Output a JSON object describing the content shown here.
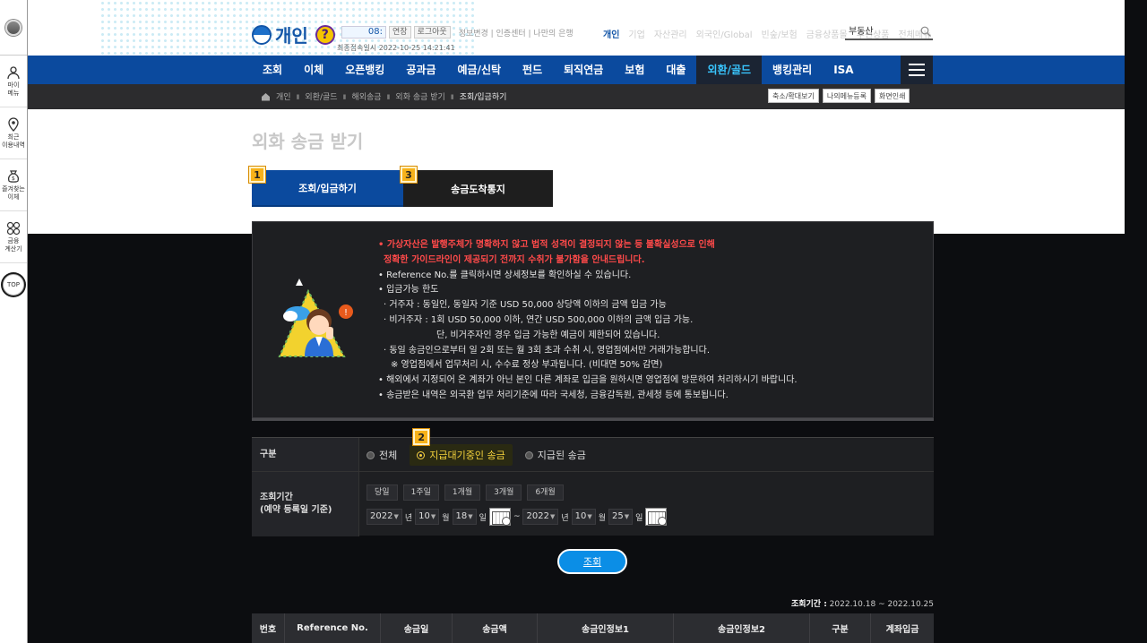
{
  "quickbar": {
    "items": [
      {
        "icon": "person-icon",
        "label": "마이\n메뉴"
      },
      {
        "icon": "location-pin-icon",
        "label": "최근\n이용내역"
      },
      {
        "icon": "money-bag-icon",
        "label": "즐겨찾는\n이체"
      },
      {
        "icon": "calculator-icon",
        "label": "금융\n계산기"
      }
    ],
    "top_label": "TOP"
  },
  "header": {
    "logo_text": "개인",
    "help_label": "?",
    "timer": "08:",
    "extend_label": "연장",
    "logout_label": "로그아웃",
    "util_links": "정보변경 | 인증센터 | 나만의 은행",
    "last_login_label": "최종접속일시",
    "last_login_value": "2022-10-25 14:21:41",
    "tabs": [
      "개인",
      "기업",
      "자산관리",
      "외국인/Global",
      "빈숲/보험",
      "금융상품몰",
      "추천상품",
      "전체메뉴"
    ],
    "search_value": "부동산"
  },
  "nav": {
    "items": [
      "조회",
      "이체",
      "오픈뱅킹",
      "공과금",
      "예금/신탁",
      "펀드",
      "퇴직연금",
      "보험",
      "대출",
      "외환/골드",
      "뱅킹관리",
      "ISA"
    ],
    "active_index": 9
  },
  "breadcrumb": {
    "items": [
      "개인",
      "외환/골드",
      "해외송금",
      "외화 송금 받기",
      "조회/입금하기"
    ],
    "tools": [
      "축소/확대보기",
      "나의메뉴등록",
      "화면인쇄"
    ]
  },
  "page": {
    "title": "외화 송금 받기",
    "tabs": [
      {
        "label": "조회/입금하기",
        "badge": "1"
      },
      {
        "label": "송금도착통지",
        "badge": "3"
      }
    ]
  },
  "notice": {
    "lines": [
      "• 가상자산은 발행주체가 명확하지 않고 법적 성격이 결정되지 않는 등 불확실성으로 인해",
      "정확한 가이드라인이 제공되기 전까지 수취가 불가함을 안내드립니다.",
      "• Reference No.를 클릭하시면 상세정보를 확인하실 수 있습니다.",
      "• 입금가능 한도",
      "· 거주자 : 동일인, 동일자 기준 USD 50,000 상당액 이하의 금액 입금 가능",
      "· 비거주자 : 1회 USD 50,000 이하, 연간 USD 500,000 이하의 금액 입금 가능.",
      "단, 비거주자인 경우 입금 가능한 예금이 제한되어 있습니다.",
      "· 동일 송금인으로부터 일 2회 또는 월 3회 초과 수취 시, 영업점에서만 거래가능합니다.",
      "※ 영업점에서 업무처리 시, 수수료 정상 부과됩니다. (비대면 50% 감면)",
      "• 해외에서 지정되어 온 계좌가 아닌 본인 다른 계좌로 입금을 원하시면 영업점에 방문하여 처리하시기 바랍니다.",
      "• 송금받은 내역은 외국환 업무 처리기준에 따라 국세청, 금융감독원, 관세청 등에 통보됩니다."
    ]
  },
  "form": {
    "type_label": "구분",
    "options": [
      "전체",
      "지급대기중인 송금",
      "지급된 송금"
    ],
    "selected_index": 1,
    "selected_badge": "2",
    "period_label_1": "조회기간",
    "period_label_2": "(예약 등록일 기준)",
    "period_buttons": [
      "당일",
      "1주일",
      "1개월",
      "3개월",
      "6개월"
    ],
    "from": {
      "year": "2022",
      "month": "10",
      "day": "18"
    },
    "to": {
      "year": "2022",
      "month": "10",
      "day": "25"
    },
    "unit_year": "년",
    "unit_month": "월",
    "unit_day": "일",
    "tilde": "~"
  },
  "search_button": "조회",
  "result": {
    "period_label": "조회기간 :",
    "period_value": "2022.10.18 ~ 2022.10.25",
    "columns": [
      "번호",
      "Reference No.",
      "송금일",
      "송금액",
      "송금인정보1",
      "송금인정보2",
      "구분",
      "계좌입금"
    ]
  }
}
